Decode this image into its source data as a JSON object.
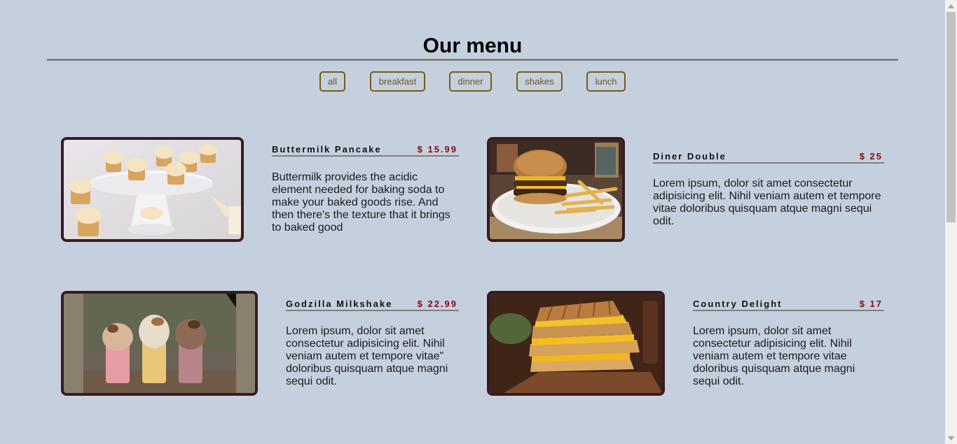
{
  "header": {
    "title": "Our menu"
  },
  "filters": [
    "all",
    "breakfast",
    "dinner",
    "shakes",
    "lunch"
  ],
  "items": [
    {
      "name": "Buttermilk Pancake",
      "price": "$ 15.99",
      "image": "cupcakes-photo",
      "desc": "Buttermilk provides the acidic element needed for baking soda to make your baked goods rise. And then there's the texture that it brings to baked good"
    },
    {
      "name": "Diner Double",
      "price": "$ 25",
      "image": "burger-fries-photo",
      "desc": "Lorem ipsum, dolor sit amet consectetur adipisicing elit. Nihil veniam autem et tempore vitae doloribus quisquam atque magni sequi odit."
    },
    {
      "name": "Godzilla Milkshake",
      "price": "$ 22.99",
      "image": "milkshakes-photo",
      "desc": "Lorem ipsum, dolor sit amet consectetur adipisicing elit. Nihil veniam autem et tempore vitae\" doloribus quisquam atque magni sequi odit."
    },
    {
      "name": "Country Delight",
      "price": "$ 17",
      "image": "grilled-sandwich-photo",
      "desc": "Lorem ipsum, dolor sit amet consectetur adipisicing elit. Nihil veniam autem et tempore vitae doloribus quisquam atque magni sequi odit."
    }
  ],
  "colors": {
    "background": "#c5d0df",
    "button_border": "#7a5a17",
    "price": "#8b0a0a",
    "image_border": "#3b1a22"
  }
}
